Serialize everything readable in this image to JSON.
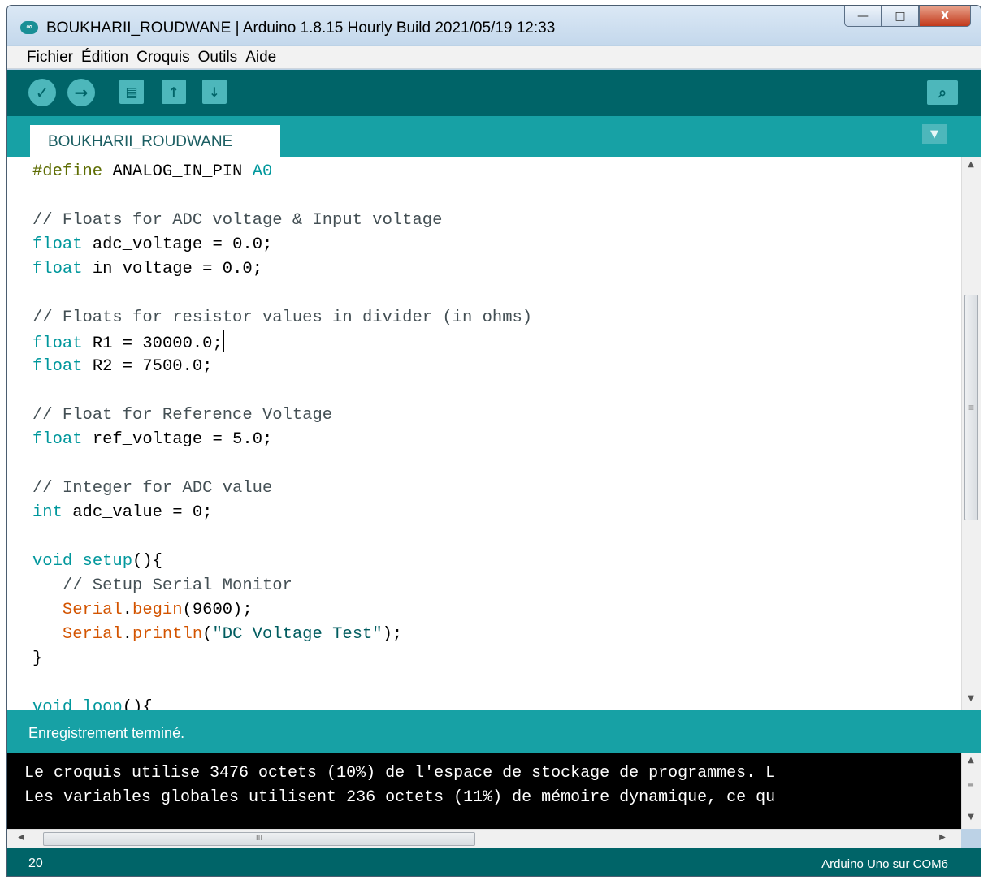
{
  "window": {
    "app_icon": "∞",
    "title": "BOUKHARII_ROUDWANE | Arduino 1.8.15 Hourly Build 2021/05/19 12:33",
    "controls": {
      "minimize": "—",
      "maximize": "□",
      "close": "X"
    }
  },
  "menu": [
    "Fichier",
    "Édition",
    "Croquis",
    "Outils",
    "Aide"
  ],
  "toolbar": {
    "verify_icon": "✓",
    "upload_icon": "→",
    "new_icon": "▤",
    "open_icon": "↑",
    "save_icon": "↓",
    "serial_monitor_icon": "⌕"
  },
  "tabs": [
    {
      "label": "BOUKHARII_ROUDWANE"
    }
  ],
  "tab_menu_icon": "▼",
  "editor": {
    "lines": [
      "#define ANALOG_IN_PIN A0",
      "",
      "// Floats for ADC voltage & Input voltage",
      "float adc_voltage = 0.0;",
      "float in_voltage = 0.0;",
      "",
      "// Floats for resistor values in divider (in ohms)",
      "float R1 = 30000.0;",
      "float R2 = 7500.0;",
      "",
      "// Float for Reference Voltage",
      "float ref_voltage = 5.0;",
      "",
      "// Integer for ADC value",
      "int adc_value = 0;",
      "",
      "void setup(){",
      "   // Setup Serial Monitor",
      "   Serial.begin(9600);",
      "   Serial.println(\"DC Voltage Test\");",
      "}",
      "",
      "void loop(){"
    ],
    "cursor_line": 8
  },
  "status": {
    "message": "Enregistrement terminé."
  },
  "console": {
    "lines": [
      "Le croquis utilise 3476 octets (10%) de l'espace de stockage de programmes. L",
      "Les variables globales utilisent 236 octets (11%) de mémoire dynamique, ce qu"
    ]
  },
  "scroll_icons": {
    "up": "▲",
    "down": "▼",
    "left": "◀",
    "right": "▶",
    "grip_v": "≡",
    "grip_h": "III"
  },
  "footer": {
    "line_number": "20",
    "board": "Arduino Uno sur COM6"
  },
  "colors": {
    "toolbar": "#006468",
    "tabbar": "#17a1a5",
    "button": "#4db7bb",
    "keyword": "#00979c",
    "function": "#d35400",
    "preprocessor": "#5e6d03",
    "comment": "#434f54"
  }
}
